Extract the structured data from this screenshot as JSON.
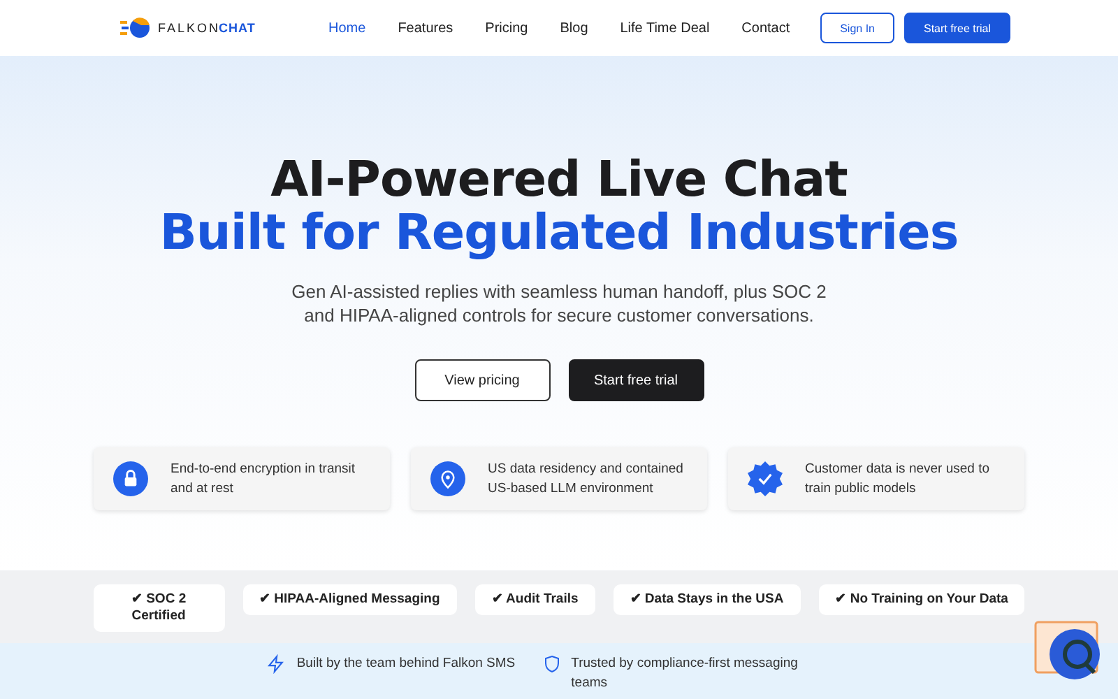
{
  "logo": {
    "word_1": "FALKON",
    "word_2": "CHAT"
  },
  "nav": [
    {
      "label": "Home",
      "selected": true
    },
    {
      "label": "Features",
      "selected": false
    },
    {
      "label": "Pricing",
      "selected": false
    },
    {
      "label": "Blog",
      "selected": false
    },
    {
      "label": "Life Time Deal",
      "selected": false
    },
    {
      "label": "Contact",
      "selected": false
    }
  ],
  "header_buttons": [
    {
      "label": "Sign In",
      "kind": "outline"
    },
    {
      "label": "Start free trial",
      "kind": "primary"
    }
  ],
  "hero": {
    "title_line_1": "AI-Powered Live Chat",
    "title_line_2": "Built for Regulated Industries",
    "subtitle": "Gen AI-assisted replies with seamless human handoff, plus SOC 2 and HIPAA-aligned controls for secure customer conversations.",
    "buttons": [
      {
        "label": "View pricing",
        "kind": "outline"
      },
      {
        "label": "Start free trial",
        "kind": "primary"
      }
    ]
  },
  "features": [
    {
      "text": "End-to-end encryption in transit and at rest"
    },
    {
      "text": "US data residency and contained US-based LLM environment"
    },
    {
      "text": "Customer data is never used to train public models"
    }
  ],
  "badges": [
    "✔ SOC 2 Certified",
    "✔ HIPAA-Aligned Messaging",
    "✔ Audit Trails",
    "✔ Data Stays in the USA",
    "✔ No Training on Your Data"
  ],
  "trust": [
    {
      "text": "Built by the team behind Falkon SMS"
    },
    {
      "text": "Trusted by compliance-first messaging teams"
    }
  ]
}
